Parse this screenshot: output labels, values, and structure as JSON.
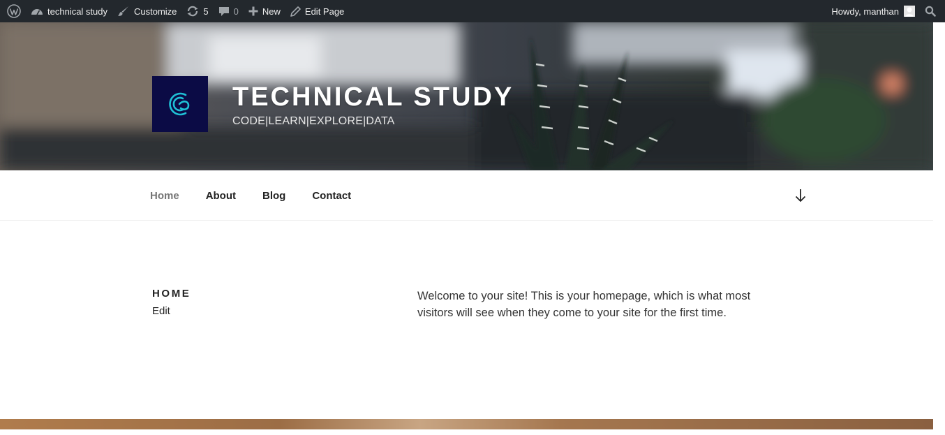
{
  "adminbar": {
    "site_name": "technical study",
    "customize_label": "Customize",
    "updates_count": "5",
    "comments_count": "0",
    "new_label": "New",
    "edit_page_label": "Edit Page",
    "howdy_label": "Howdy, manthan"
  },
  "header": {
    "site_title": "TECHNICAL STUDY",
    "site_description": "CODE|LEARN|EXPLORE|DATA"
  },
  "nav": {
    "items": [
      {
        "label": "Home",
        "current": true
      },
      {
        "label": "About"
      },
      {
        "label": "Blog"
      },
      {
        "label": "Contact"
      }
    ]
  },
  "content": {
    "page_title": "HOME",
    "edit_label": "Edit",
    "entry_text": "Welcome to your site! This is your homepage, which is what most visitors will see when they come to your site for the first time."
  },
  "colors": {
    "adminbar_bg": "#23282d",
    "logo_bg": "#0b0b45",
    "logo_accent": "#1fc1d6"
  },
  "icons": [
    "wordpress-icon",
    "dashboard-icon",
    "brush-icon",
    "updates-icon",
    "comment-icon",
    "plus-icon",
    "pencil-icon",
    "search-icon",
    "arrow-down-icon"
  ]
}
